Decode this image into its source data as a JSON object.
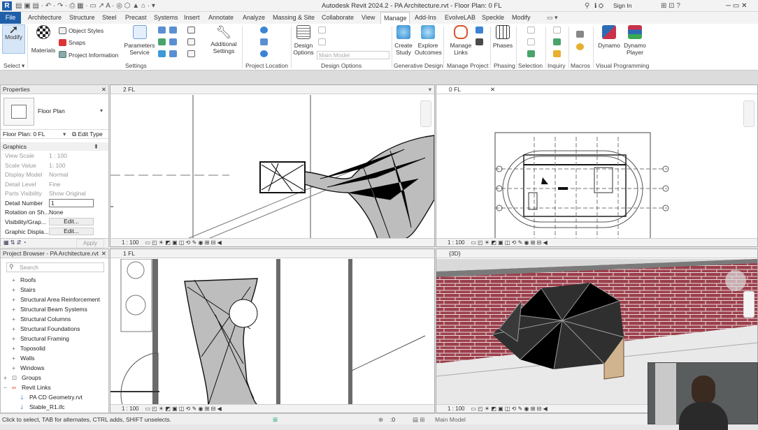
{
  "app": {
    "title": "Autodesk Revit 2024.2 - PA Architecture.rvt - Floor Plan: 0 FL",
    "sign_in": "Sign In"
  },
  "tabs": [
    "File",
    "Architecture",
    "Structure",
    "Steel",
    "Precast",
    "Systems",
    "Insert",
    "Annotate",
    "Analyze",
    "Massing & Site",
    "Collaborate",
    "View",
    "Manage",
    "Add-Ins",
    "EvolveLAB",
    "Speckle",
    "Modify"
  ],
  "ribbon": {
    "modify": "Modify",
    "select": "Select",
    "materials": "Materials",
    "object_styles": "Object Styles",
    "snaps": "Snaps",
    "project_information": "Project Information",
    "parameters_service": "Parameters\nService",
    "additional_settings": "Additional\nSettings",
    "design_options": "Design\nOptions",
    "main_model": "Main Model",
    "create_study": "Create\nStudy",
    "explore_outcomes": "Explore\nOutcomes",
    "manage_links": "Manage\nLinks",
    "phases": "Phases",
    "dynamo": "Dynamo",
    "dynamo_player": "Dynamo\nPlayer",
    "panels": {
      "settings": "Settings",
      "project_location": "Project Location",
      "design_options": "Design Options",
      "generative_design": "Generative Design",
      "manage_project": "Manage Project",
      "phasing": "Phasing",
      "selection": "Selection",
      "inquiry": "Inquiry",
      "macros": "Macros",
      "visual_programming": "Visual Programming"
    }
  },
  "properties": {
    "title": "Properties",
    "type": "Floor Plan",
    "instance": "Floor Plan: 0 FL",
    "edit_type": "Edit Type",
    "section": "Graphics",
    "rows": [
      {
        "k": "View Scale",
        "v": "1 : 100"
      },
      {
        "k": "Scale Value",
        "v": "1:  100"
      },
      {
        "k": "Display Model",
        "v": "Normal"
      },
      {
        "k": "Detail Level",
        "v": "Fine"
      },
      {
        "k": "Parts Visibility",
        "v": "Show Original"
      },
      {
        "k": "Detail Number",
        "v": "1"
      },
      {
        "k": "Rotation on Sh...",
        "v": "None"
      },
      {
        "k": "Visibility/Grap...",
        "v": "Edit..."
      },
      {
        "k": "Graphic Displa...",
        "v": "Edit..."
      }
    ],
    "apply": "Apply"
  },
  "browser": {
    "title": "Project Browser - PA Architecture.rvt",
    "search": "Search",
    "items": [
      "Roofs",
      "Stairs",
      "Structural Area Reinforcement",
      "Structural Beam Systems",
      "Structural Columns",
      "Structural Foundations",
      "Structural Framing",
      "Toposolid",
      "Walls",
      "Windows"
    ],
    "groups": "Groups",
    "revit_links": "Revit Links",
    "links": [
      "PA CD Geometry.rvt",
      "Stable_R1.ifc"
    ]
  },
  "views": {
    "v1": "2 FL",
    "v2": "0 FL",
    "v3": "1 FL",
    "v4": "{3D}",
    "scale": "1 : 100"
  },
  "status": {
    "hint": "Click to select, TAB for alternates, CTRL adds, SHIFT unselects.",
    "zero": ":0",
    "model": "Main Model"
  }
}
